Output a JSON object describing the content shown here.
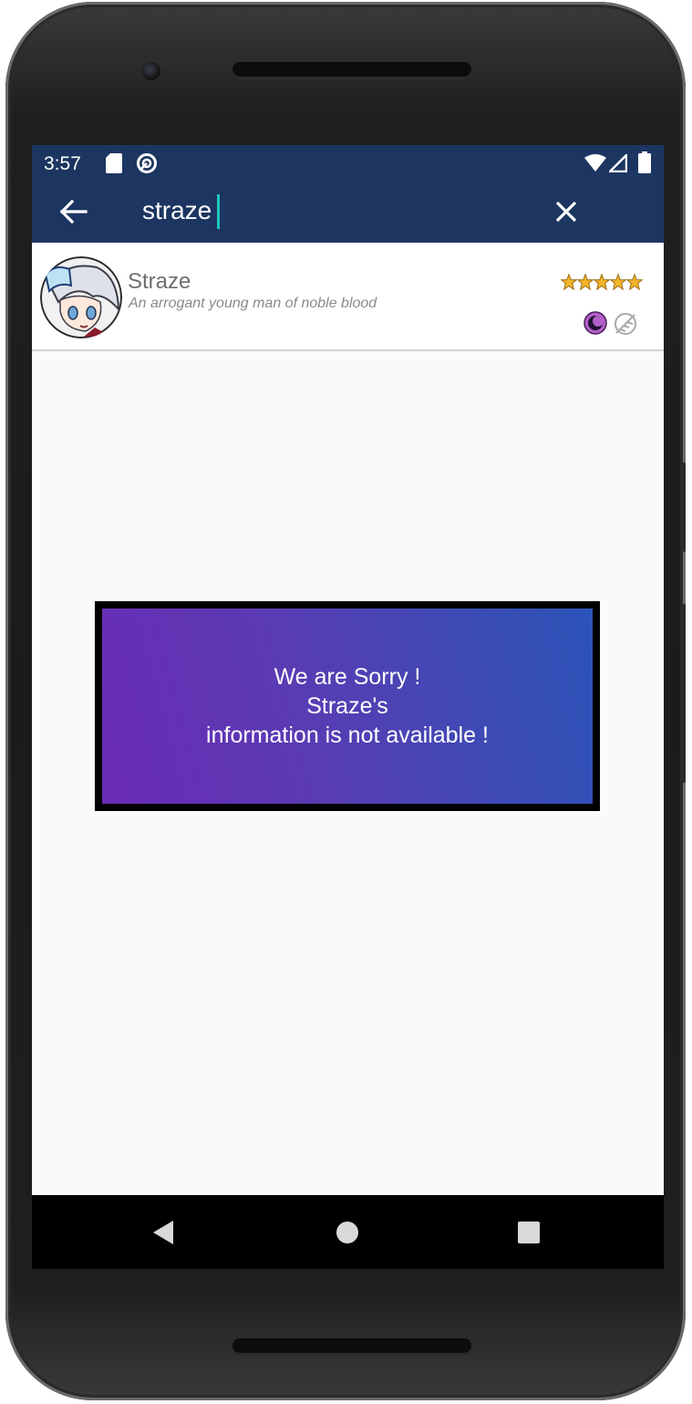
{
  "status_bar": {
    "time": "3:57"
  },
  "search": {
    "query": "straze"
  },
  "result": {
    "name": "Straze",
    "description": "An arrogant young man of noble blood",
    "rating_stars": 5,
    "icons": [
      "dark-element-icon",
      "class-emblem-icon"
    ]
  },
  "message": {
    "line1": "We are Sorry !",
    "line2": "Straze's",
    "line3": "information is not available !"
  },
  "colors": {
    "app_bar": "#1c3661",
    "caret": "#1ec8b6",
    "gradient_start": "#6b2bb5",
    "gradient_end": "#2c54b8"
  }
}
